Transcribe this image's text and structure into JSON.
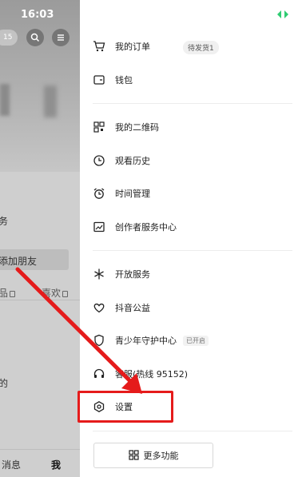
{
  "background": {
    "time": "16:03",
    "pill_text": "15",
    "row_text": "务",
    "add_friend": "添加朋友",
    "tab_left_partial": "品",
    "tab_like": "喜欢",
    "mid_text": "的",
    "bottom_tabs": {
      "messages": "消息",
      "me": "我"
    }
  },
  "drawer": {
    "group1": [
      {
        "name": "orders",
        "label": "我的订单",
        "icon": "cart-icon"
      },
      {
        "name": "wallet",
        "label": "钱包",
        "icon": "wallet-icon"
      }
    ],
    "order_badge": "待发货1",
    "group2": [
      {
        "name": "qrcode",
        "label": "我的二维码",
        "icon": "qrcode-icon"
      },
      {
        "name": "history",
        "label": "观看历史",
        "icon": "clock-icon"
      },
      {
        "name": "time",
        "label": "时间管理",
        "icon": "alarm-icon"
      },
      {
        "name": "creator",
        "label": "创作者服务中心",
        "icon": "chart-icon"
      }
    ],
    "group3": [
      {
        "name": "open",
        "label": "开放服务",
        "icon": "star-burst-icon"
      },
      {
        "name": "charity",
        "label": "抖音公益",
        "icon": "heart-hand-icon"
      },
      {
        "name": "youth",
        "label": "青少年守护中心",
        "icon": "shield-icon"
      },
      {
        "name": "support",
        "label": "客服(热线 95152)",
        "icon": "headset-icon"
      },
      {
        "name": "settings",
        "label": "设置",
        "icon": "hexagon-gear-icon"
      }
    ],
    "youth_badge": "已开启",
    "more_label": "更多功能"
  },
  "colors": {
    "highlight": "#e51b1b",
    "top_icon": "#2ecc71"
  }
}
